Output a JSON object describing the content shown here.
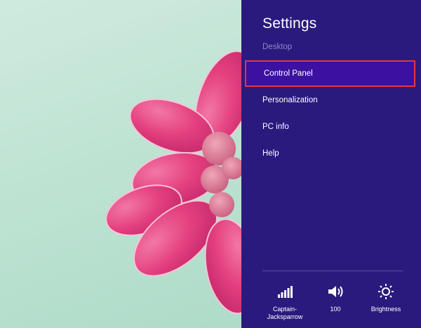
{
  "charm": {
    "title": "Settings",
    "context": "Desktop",
    "items": [
      {
        "label": "Control Panel"
      },
      {
        "label": "Personalization"
      },
      {
        "label": "PC info"
      },
      {
        "label": "Help"
      }
    ],
    "tray": {
      "network": {
        "label": "Captain-Jacksparrow",
        "icon": "network-signal-icon"
      },
      "volume": {
        "label": "100",
        "icon": "speaker-icon"
      },
      "brightness": {
        "label": "Brightness",
        "icon": "brightness-icon"
      }
    }
  },
  "colors": {
    "charm_bg": "#2a1a7e",
    "highlight_bg": "#3c10a0",
    "highlight_border": "#e5353f",
    "muted_text": "#8f86c9",
    "petal_pink": "#e4407f"
  }
}
